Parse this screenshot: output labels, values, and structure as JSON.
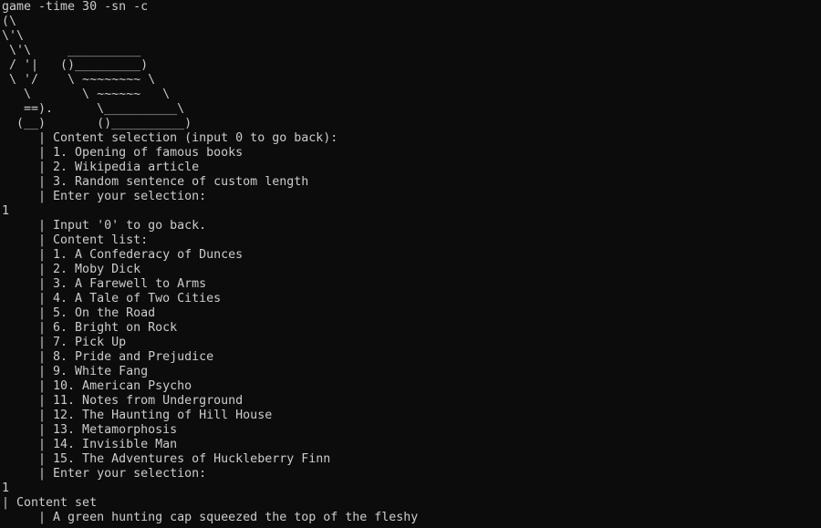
{
  "terminal": {
    "lines": [
      "game -time 30 -sn -c",
      "(\\",
      "\\'\\",
      " \\'\\     __________",
      " / '|   ()_________)",
      " \\ '/    \\ ~~~~~~~~ \\",
      "   \\       \\ ~~~~~~   \\",
      "   ==).      \\__________\\",
      "  (__)       ()__________)",
      "     | Content selection (input 0 to go back):",
      "     | 1. Opening of famous books",
      "     | 2. Wikipedia article",
      "     | 3. Random sentence of custom length",
      "     | Enter your selection:",
      "1",
      "     | Input '0' to go back.",
      "     | Content list:",
      "     | 1. A Confederacy of Dunces",
      "     | 2. Moby Dick",
      "     | 3. A Farewell to Arms",
      "     | 4. A Tale of Two Cities",
      "     | 5. On the Road",
      "     | 6. Bright on Rock",
      "     | 7. Pick Up",
      "     | 8. Pride and Prejudice",
      "     | 9. White Fang",
      "     | 10. American Psycho",
      "     | 11. Notes from Underground",
      "     | 12. The Haunting of Hill House",
      "     | 13. Metamorphosis",
      "     | 14. Invisible Man",
      "     | 15. The Adventures of Huckleberry Finn",
      "     | Enter your selection:",
      "1",
      "| Content set",
      "     | A green hunting cap squeezed the top of the fleshy"
    ]
  }
}
